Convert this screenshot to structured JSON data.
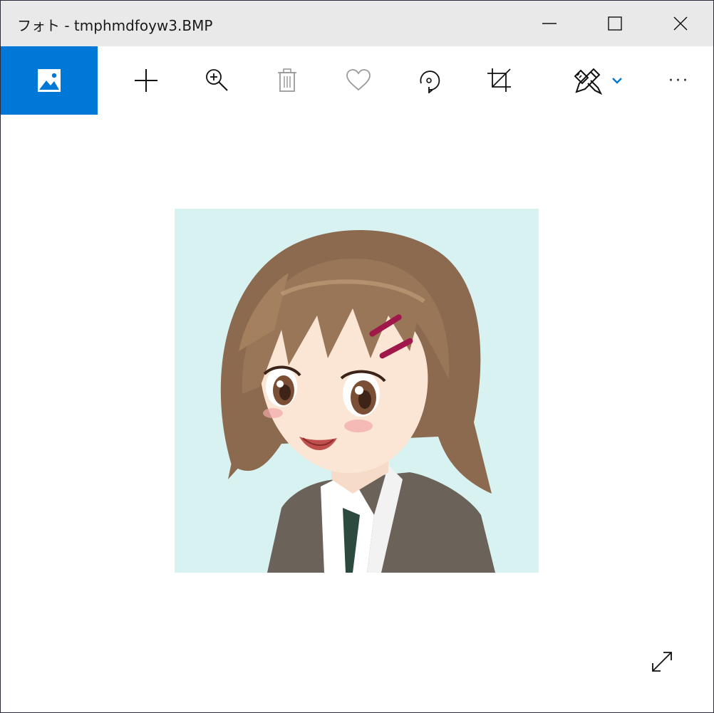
{
  "window": {
    "title": "フォト - tmphmdfoyw3.BMP",
    "controls": {
      "minimize": "minimize-icon",
      "maximize": "maximize-icon",
      "close": "close-icon"
    }
  },
  "toolbar": {
    "items": [
      {
        "icon": "image-collection-icon",
        "name": "view-all-photos-button"
      },
      {
        "icon": "plus-icon",
        "name": "add-button"
      },
      {
        "icon": "zoom-in-icon",
        "name": "zoom-button"
      },
      {
        "icon": "trash-icon",
        "name": "delete-button"
      },
      {
        "icon": "heart-icon",
        "name": "favorite-button"
      },
      {
        "icon": "rotate-icon",
        "name": "rotate-button"
      },
      {
        "icon": "crop-icon",
        "name": "crop-button"
      },
      {
        "icon": "edit-create-icon",
        "name": "edit-create-button"
      },
      {
        "icon": "more-icon",
        "name": "more-button"
      }
    ],
    "more_glyph": "···"
  },
  "colors": {
    "accent": "#0078d7",
    "titlebar": "#e9e9e9",
    "photo_background": "#d8f1f1",
    "hair": "#8b6a4f",
    "jacket": "#6b6259"
  },
  "photo": {
    "description_icon": "anime-girl-portrait-image"
  },
  "fit_button": {
    "icon": "expand-icon"
  }
}
